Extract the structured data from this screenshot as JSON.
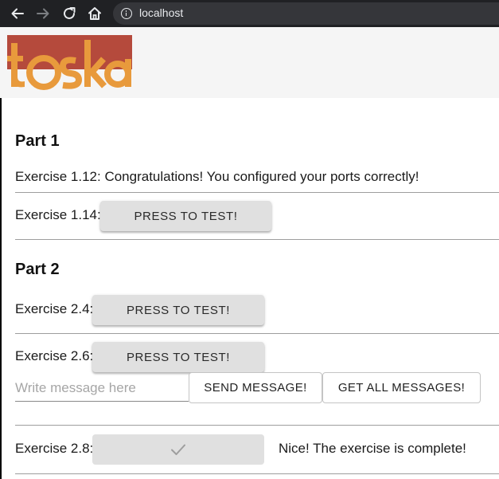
{
  "browser": {
    "url": "localhost",
    "back_icon": "arrow-left-icon",
    "forward_icon": "arrow-right-icon",
    "reload_icon": "reload-icon",
    "home_icon": "home-icon",
    "info_icon": "info-icon"
  },
  "header": {
    "logo_text": "toska",
    "colors": {
      "logo_red": "#b54a3c",
      "logo_orange": "#e89a3c",
      "header_bg": "#f5f5f5"
    }
  },
  "part1": {
    "title": "Part 1",
    "ex_1_12": "Exercise 1.12: Congratulations! You configured your ports correctly!",
    "ex_1_14_label": "Exercise 1.14:",
    "ex_1_14_button": "PRESS TO TEST!"
  },
  "part2": {
    "title": "Part 2",
    "ex_2_4_label": "Exercise 2.4:",
    "ex_2_4_button": "PRESS TO TEST!",
    "ex_2_6_label": "Exercise 2.6:",
    "ex_2_6_button": "PRESS TO TEST!",
    "message_input": {
      "value": "",
      "placeholder": "Write message here"
    },
    "send_button": "SEND MESSAGE!",
    "get_all_button": "GET ALL MESSAGES!",
    "ex_2_8_label": "Exercise 2.8:",
    "ex_2_8_button_icon": "check-icon",
    "ex_2_8_status": "Nice! The exercise is complete!"
  }
}
